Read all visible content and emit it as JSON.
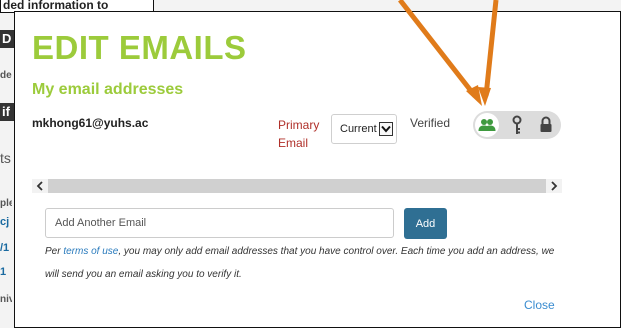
{
  "background": {
    "top_fragment": "ded information to",
    "fragments": [
      "D",
      "de",
      "if F",
      "ts",
      "ple",
      "cj",
      "/1",
      "1",
      "niv"
    ]
  },
  "modal": {
    "title": "EDIT EMAILS",
    "subtitle": "My email addresses",
    "email_row": {
      "address": "mkhong61@yuhs.ac",
      "type_label": "Primary Email",
      "status_select": {
        "selected": "Current"
      },
      "verified_label": "Verified",
      "icons": [
        "people-icon",
        "key-icon",
        "lock-icon"
      ]
    },
    "scrollbar": {
      "left": "‹",
      "right": "›"
    },
    "add_email": {
      "placeholder": "Add Another Email",
      "button_label": "Add"
    },
    "notice": {
      "prefix": "Per ",
      "link": "terms of use",
      "suffix": ", you may only add email addresses that you have control over. Each time you add an address, we will send you an email asking you to verify it."
    },
    "close_label": "Close"
  },
  "colors": {
    "title_green": "#9ccb3b",
    "primary_red": "#b0302a",
    "button_blue": "#2f6f93",
    "link_blue": "#3a8cd0",
    "annotation_orange": "#e07b1a",
    "icon_green": "#3f9a3f"
  }
}
